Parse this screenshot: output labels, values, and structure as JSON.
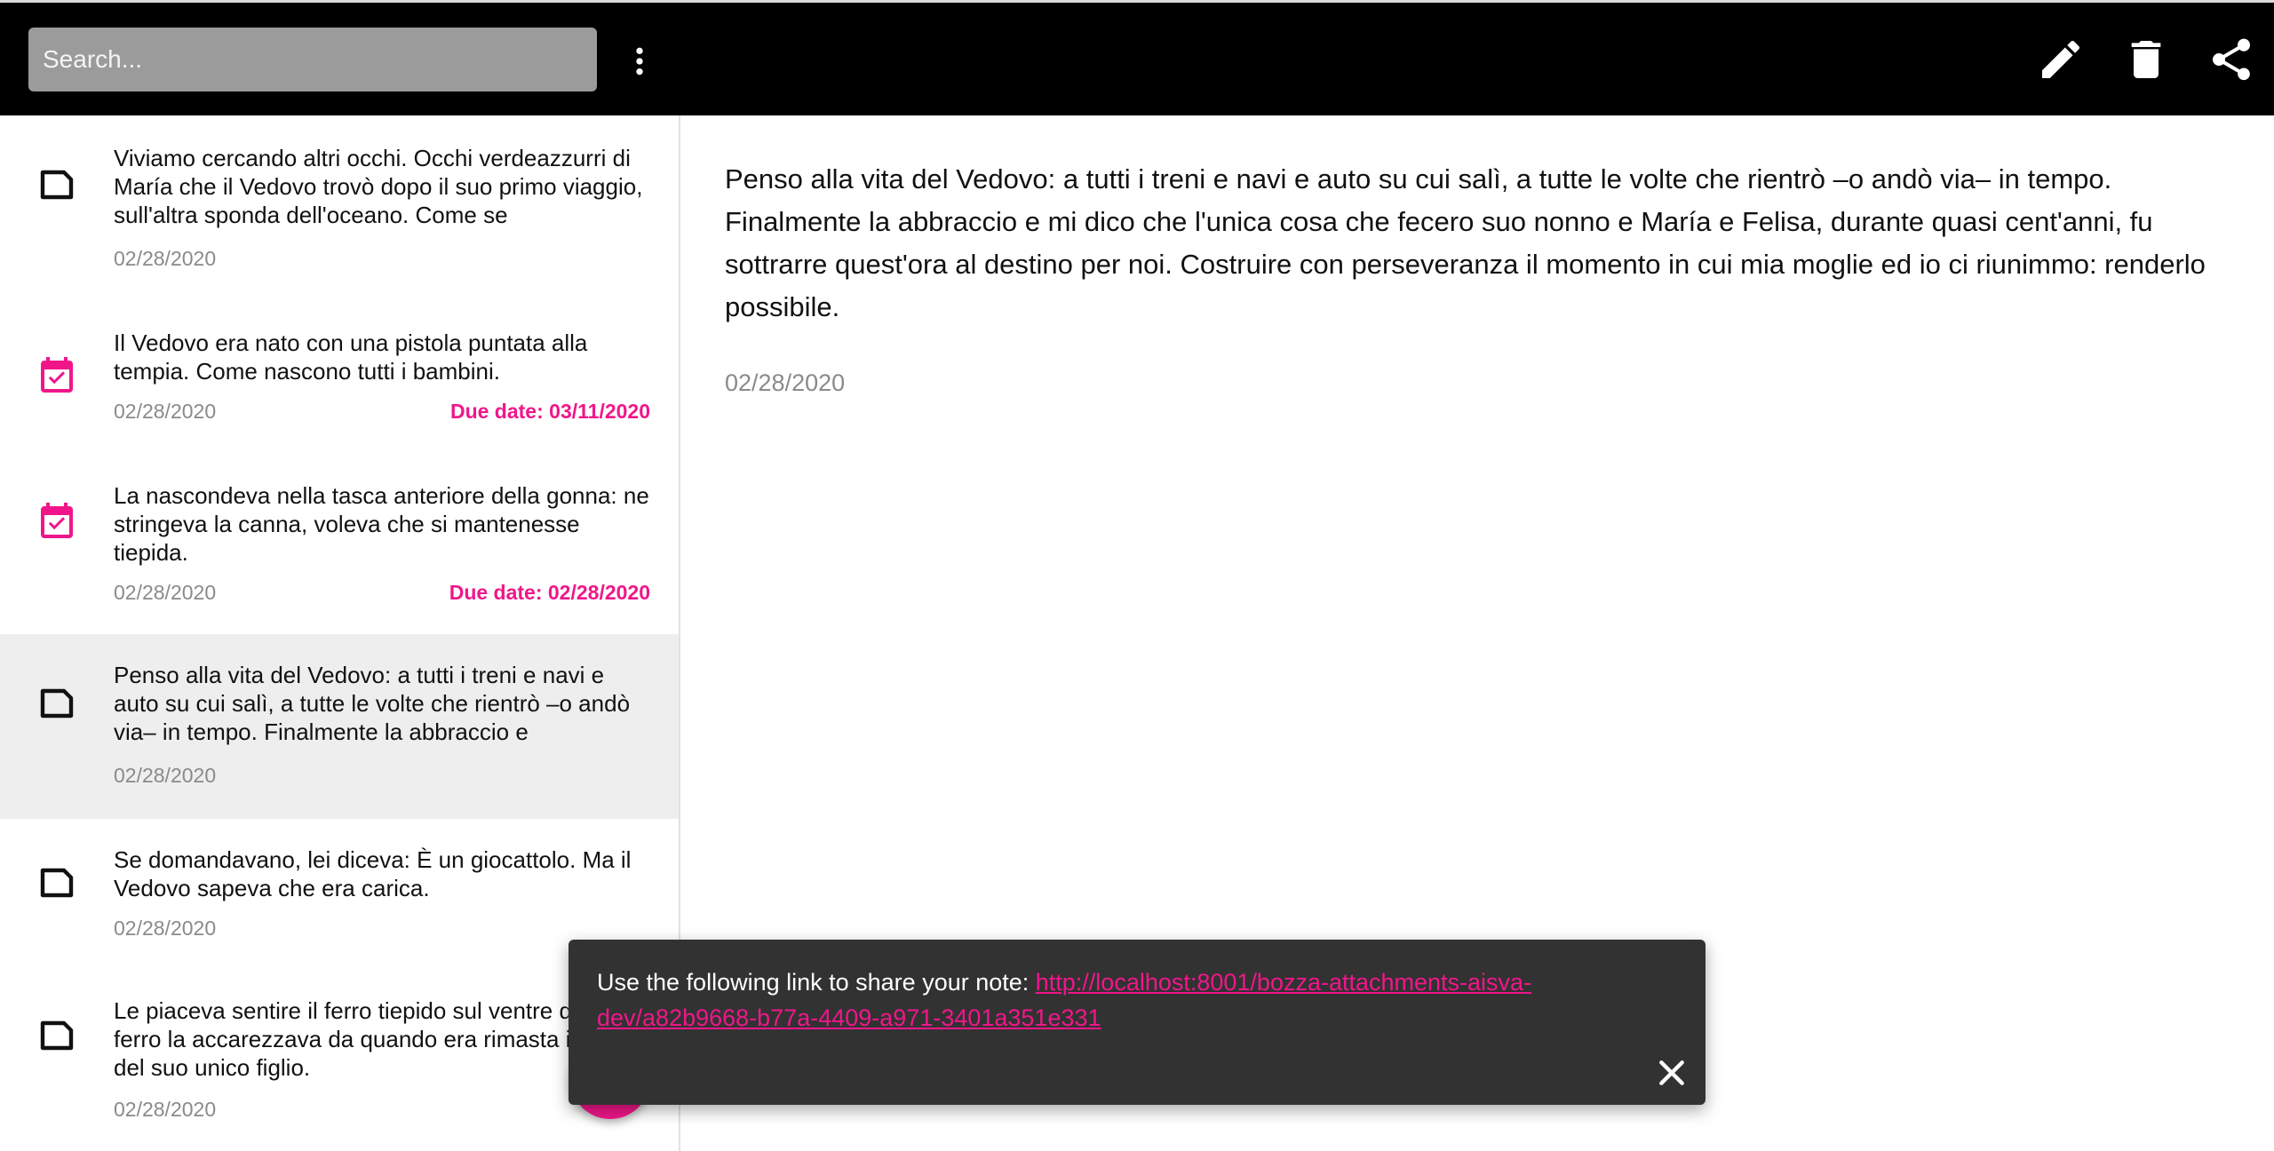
{
  "header": {
    "search_placeholder": "Search...",
    "actions": [
      "edit-icon",
      "delete-icon",
      "share-icon"
    ]
  },
  "notes": [
    {
      "type": "note",
      "text": "Viviamo cercando altri occhi. Occhi verdeazzurri di María che il Vedovo trovò dopo il suo primo viaggio, sull'altra sponda dell'oceano. Come se",
      "date": "02/28/2020",
      "due": ""
    },
    {
      "type": "task",
      "text": "Il Vedovo era nato con una pistola puntata alla tempia. Come nascono tutti i bambini.",
      "date": "02/28/2020",
      "due": "Due date: 03/11/2020"
    },
    {
      "type": "task",
      "text": "La nascondeva nella tasca anteriore della gonna: ne stringeva la canna, voleva che si mantenesse tiepida.",
      "date": "02/28/2020",
      "due": "Due date: 02/28/2020"
    },
    {
      "type": "note",
      "text": "Penso alla vita del Vedovo: a tutti i treni e navi e auto su cui salì, a tutte le volte che rientrò –o andò via– in tempo. Finalmente la abbraccio e",
      "date": "02/28/2020",
      "due": ""
    },
    {
      "type": "note",
      "text": "Se domandavano, lei diceva: È un giocattolo. Ma il Vedovo sapeva che era carica.",
      "date": "02/28/2020",
      "due": ""
    },
    {
      "type": "note",
      "text": "Le piaceva sentire il ferro tiepido sul ventre dito di ferro la accarezzava da quando era rimasta incinta del suo unico figlio.",
      "date": "02/28/2020",
      "due": ""
    }
  ],
  "detail": {
    "text": "Penso alla vita del Vedovo: a tutti i treni e navi e auto su cui salì, a tutte le volte che rientrò –o andò via– in tempo. Finalmente la abbraccio e mi dico che l'unica cosa che fecero suo nonno e María e Felisa, durante quasi cent'anni, fu sottrarre quest'ora al destino per noi. Costruire con perseveranza il momento in cui mia moglie ed io ci riunimmo: renderlo possibile.",
    "date": "02/28/2020"
  },
  "snackbar": {
    "message": "Use the following link to share your note: ",
    "link": "http://localhost:8001/bozza-attachments-aisva-dev/a82b9668-b77a-4409-a971-3401a351e331"
  },
  "colors": {
    "accent": "#f0168a",
    "topbar": "#000000",
    "selected_row": "#eeeeee",
    "snackbar": "#323232"
  }
}
